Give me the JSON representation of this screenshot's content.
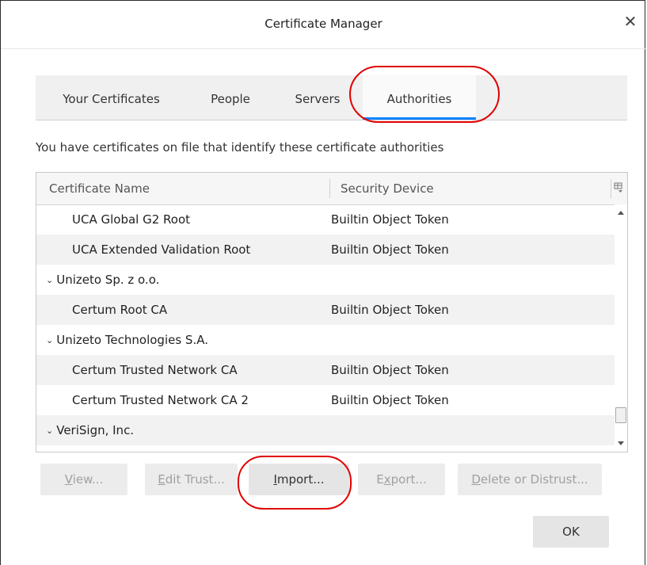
{
  "window": {
    "title": "Certificate Manager",
    "close_symbol": "✕"
  },
  "tabs": [
    {
      "label": "Your Certificates",
      "selected": false
    },
    {
      "label": "People",
      "selected": false
    },
    {
      "label": "Servers",
      "selected": false
    },
    {
      "label": "Authorities",
      "selected": true
    }
  ],
  "description": "You have certificates on file that identify these certificate authorities",
  "table": {
    "columns": [
      "Certificate Name",
      "Security Device"
    ],
    "rows": [
      {
        "name": "UCA Global G2 Root",
        "device": "Builtin Object Token",
        "group": false
      },
      {
        "name": "UCA Extended Validation Root",
        "device": "Builtin Object Token",
        "group": false
      },
      {
        "name": "Unizeto Sp. z o.o.",
        "device": "",
        "group": true
      },
      {
        "name": "Certum Root CA",
        "device": "Builtin Object Token",
        "group": false
      },
      {
        "name": "Unizeto Technologies S.A.",
        "device": "",
        "group": true
      },
      {
        "name": "Certum Trusted Network CA",
        "device": "Builtin Object Token",
        "group": false
      },
      {
        "name": "Certum Trusted Network CA 2",
        "device": "Builtin Object Token",
        "group": false
      },
      {
        "name": "VeriSign, Inc.",
        "device": "",
        "group": true
      }
    ]
  },
  "buttons": {
    "view": {
      "pre": "",
      "key": "V",
      "post": "iew..."
    },
    "edit_trust": {
      "pre": "",
      "key": "E",
      "post": "dit Trust..."
    },
    "import": {
      "pre": "",
      "key": "I",
      "post": "mport..."
    },
    "export": {
      "pre": "E",
      "key": "x",
      "post": "port..."
    },
    "delete": {
      "pre": "",
      "key": "D",
      "post": "elete or Distrust..."
    },
    "ok": "OK"
  },
  "colors": {
    "accent": "#0a84ff",
    "annotation": "#e00000"
  }
}
